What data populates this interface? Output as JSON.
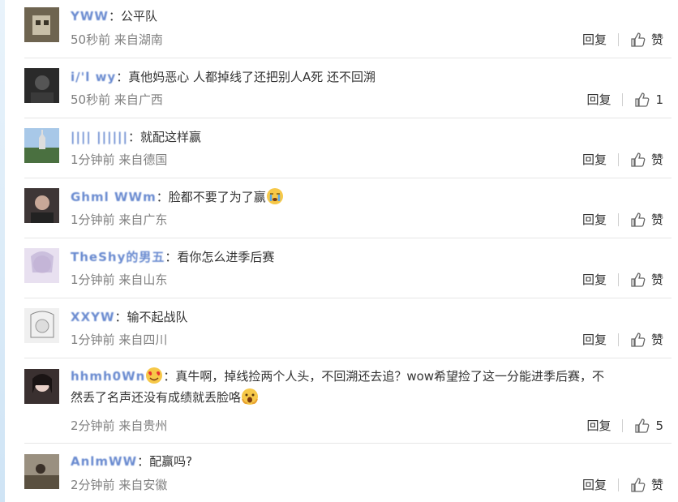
{
  "comments": [
    {
      "user": "YWW",
      "text": "：公平队",
      "time": "50秒前",
      "from": "来自湖南",
      "reply": "回复",
      "like": "赞",
      "avatar_color": "#5a5040"
    },
    {
      "user": "i/'l wy",
      "text": "：真他妈恶心 人都掉线了还把别人A死 还不回溯",
      "time": "50秒前",
      "from": "来自广西",
      "reply": "回复",
      "like": "1",
      "avatar_color": "#2b2b2b"
    },
    {
      "user": "|||| ||||||",
      "text": "：就配这样赢",
      "time": "1分钟前",
      "from": "来自德国",
      "reply": "回复",
      "like": "赞",
      "avatar_color": "#6b8a68"
    },
    {
      "user": "Ghml  WWm",
      "text": "：脸都不要了为了赢",
      "time": "1分钟前",
      "from": "来自广东",
      "reply": "回复",
      "like": "赞",
      "avatar_color": "#4a4040"
    },
    {
      "user": "TheShy的男五",
      "text": "：看你怎么进季后赛",
      "time": "1分钟前",
      "from": "来自山东",
      "reply": "回复",
      "like": "赞",
      "avatar_color": "#d8d0e8"
    },
    {
      "user": "XXYW",
      "text": "：输不起战队",
      "time": "1分钟前",
      "from": "来自四川",
      "reply": "回复",
      "like": "赞",
      "avatar_color": "#e8e8e8"
    },
    {
      "user": "hhmh0Wn",
      "text": "：真牛啊，掉线捡两个人头，不回溯还去追？wow希望捡了这一分能进季后赛，不",
      "text2": "然丢了名声还没有成绩就丢脸咯",
      "time": "2分钟前",
      "from": "来自贵州",
      "reply": "回复",
      "like": "5",
      "avatar_color": "#3a3030"
    },
    {
      "user": "AnlmWW",
      "text": "：配赢吗?",
      "time": "2分钟前",
      "from": "来自安徽",
      "reply": "回复",
      "like": "赞",
      "avatar_color": "#8a8070"
    }
  ]
}
